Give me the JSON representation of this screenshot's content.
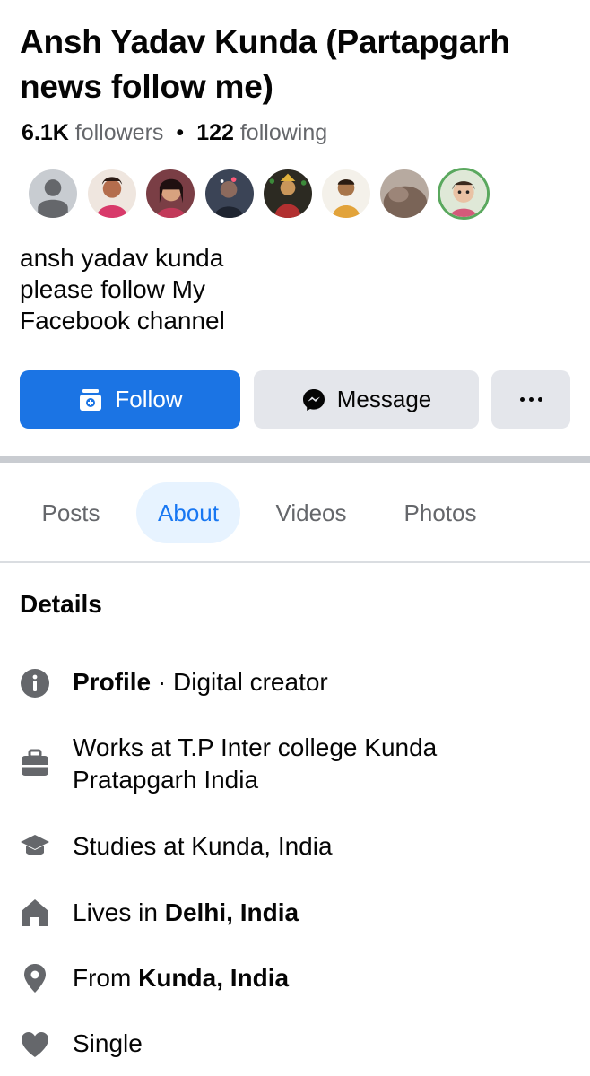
{
  "profile": {
    "name": "Ansh Yadav Kunda (Partapgarh news follow me)",
    "followers_count": "6.1K",
    "followers_label": "followers",
    "separator": "•",
    "following_count": "122",
    "following_label": "following",
    "bio_lines": [
      "ansh yadav kunda",
      "please follow My",
      "Facebook channel"
    ]
  },
  "friend_avatars": [
    {
      "icon": "default-avatar-icon",
      "color": "#c8ccd1"
    },
    {
      "icon": "friend-photo",
      "color": "#e8c4b0"
    },
    {
      "icon": "friend-photo",
      "color": "#7a3e45"
    },
    {
      "icon": "friend-photo",
      "color": "#3b4456"
    },
    {
      "icon": "friend-photo",
      "color": "#3d3528"
    },
    {
      "icon": "friend-photo",
      "color": "#c79a5a"
    },
    {
      "icon": "friend-photo",
      "color": "#8a7566"
    },
    {
      "icon": "friend-photo",
      "color": "#5aa85e"
    }
  ],
  "actions": {
    "follow_label": "Follow",
    "follow_icon": "follow-add-icon",
    "message_label": "Message",
    "message_icon": "messenger-icon",
    "more_icon": "more-dots-icon"
  },
  "tabs": [
    {
      "label": "Posts",
      "active": false
    },
    {
      "label": "About",
      "active": true
    },
    {
      "label": "Videos",
      "active": false
    },
    {
      "label": "Photos",
      "active": false
    }
  ],
  "details": {
    "title": "Details",
    "profile": {
      "icon": "info-icon",
      "bold": "Profile",
      "rest": " · Digital creator"
    },
    "work": {
      "icon": "briefcase-icon",
      "line1": "Works at T.P Inter college Kunda",
      "line2": "Pratapgarh India"
    },
    "study": {
      "icon": "graduation-cap-icon",
      "prefix": "Studies at Kunda, India"
    },
    "lives": {
      "icon": "home-icon",
      "prefix": "Lives in ",
      "bold": "Delhi, India"
    },
    "from": {
      "icon": "location-pin-icon",
      "prefix": "From ",
      "bold": "Kunda, India"
    },
    "relationship": {
      "icon": "heart-icon",
      "text": "Single"
    }
  },
  "colors": {
    "accent": "#1b74e4",
    "tab_active_bg": "#e7f3ff",
    "secondary_text": "#65676b",
    "button_gray": "#e4e6eb"
  }
}
